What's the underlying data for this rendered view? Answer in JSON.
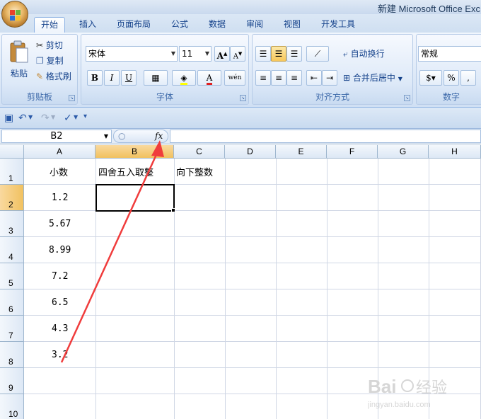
{
  "window": {
    "title": "新建 Microsoft Office Exc"
  },
  "tabs": [
    {
      "label": "开始",
      "active": true
    },
    {
      "label": "插入"
    },
    {
      "label": "页面布局"
    },
    {
      "label": "公式"
    },
    {
      "label": "数据"
    },
    {
      "label": "审阅"
    },
    {
      "label": "视图"
    },
    {
      "label": "开发工具"
    }
  ],
  "ribbon": {
    "clipboard": {
      "label": "剪贴板",
      "paste": "粘贴",
      "cut": "剪切",
      "copy": "复制",
      "format_painter": "格式刷"
    },
    "font": {
      "label": "字体",
      "font_name": "宋体",
      "font_size": "11",
      "bold": "B",
      "italic": "I",
      "underline": "U"
    },
    "alignment": {
      "label": "对齐方式",
      "wrap_text": "自动换行",
      "merge_center": "合并后居中"
    },
    "number": {
      "label": "数字",
      "format": "常规",
      "percent": "%",
      "comma": ","
    }
  },
  "formula_bar": {
    "name_box": "B2",
    "fx": "fx",
    "value": ""
  },
  "sheet": {
    "columns": [
      "A",
      "B",
      "C",
      "D",
      "E",
      "F",
      "G",
      "H"
    ],
    "rows": [
      "1",
      "2",
      "3",
      "4",
      "5",
      "6",
      "7",
      "8",
      "9",
      "10"
    ],
    "selected_cell": "B2",
    "cells": {
      "A1": "小数",
      "B1": "四舍五入取整",
      "C1": "向下整数",
      "A2": "1.2",
      "A3": "5.67",
      "A4": "8.99",
      "A5": "7.2",
      "A6": "6.5",
      "A7": "4.3",
      "A8": "3.2"
    }
  },
  "colors": {
    "accent": "#15428b",
    "selection": "#f1c15f",
    "arrow": "#f03c3c"
  }
}
